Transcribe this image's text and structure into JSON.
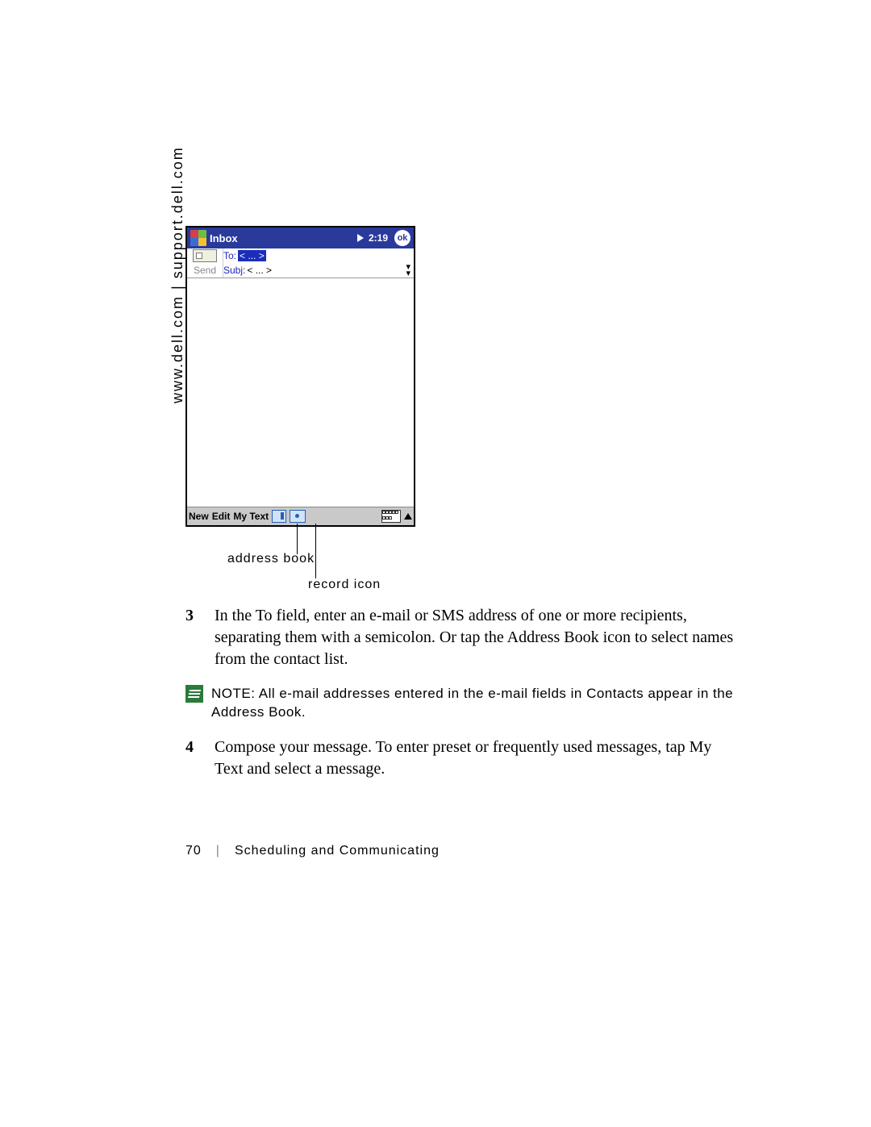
{
  "side_text": "www.dell.com | support.dell.com",
  "pda": {
    "title": "Inbox",
    "time": "2:19",
    "ok": "ok",
    "to_label": "To:",
    "to_value": "< ... >",
    "subj_label": "Subj:",
    "subj_value": "< ... >",
    "send": "Send",
    "menu_new": "New",
    "menu_edit": "Edit",
    "menu_mytext": "My Text"
  },
  "callouts": {
    "address_book": "address book",
    "record_icon": "record icon"
  },
  "steps": {
    "s3_num": "3",
    "s3_text": "In the To field, enter an e-mail or SMS address of one or more recipients, separating them with a semicolon. Or tap the Address Book icon to select names from the contact list.",
    "note_label": "NOTE: ",
    "note_text": "All e-mail addresses entered in the e-mail fields in Contacts appear in the Address Book.",
    "s4_num": "4",
    "s4_text": "Compose your message. To enter preset or frequently used messages, tap My Text and select a message."
  },
  "footer": {
    "page": "70",
    "section": "Scheduling and Communicating"
  }
}
